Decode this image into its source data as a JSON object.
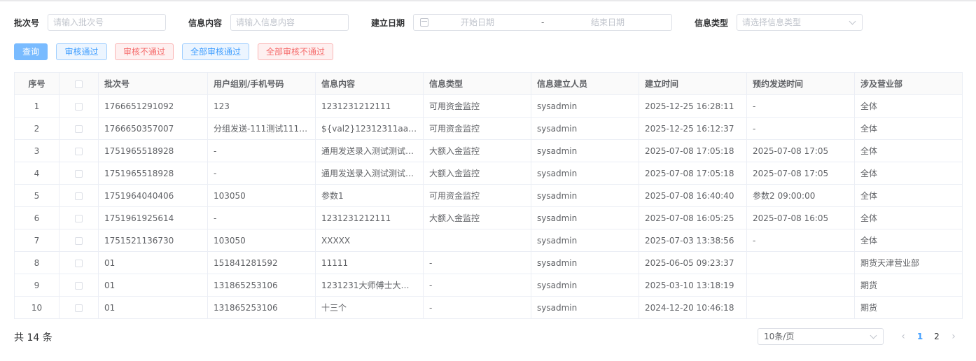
{
  "filters": {
    "batch_label": "批次号",
    "batch_placeholder": "请输入批次号",
    "content_label": "信息内容",
    "content_placeholder": "请输入信息内容",
    "date_label": "建立日期",
    "date_start_placeholder": "开始日期",
    "date_separator": "-",
    "date_end_placeholder": "结束日期",
    "type_label": "信息类型",
    "type_placeholder": "请选择信息类型"
  },
  "buttons": {
    "query": "查询",
    "approve": "审核通过",
    "reject": "审核不通过",
    "approve_all": "全部审核通过",
    "reject_all": "全部审核不通过"
  },
  "table": {
    "headers": [
      "序号",
      "",
      "批次号",
      "用户组别/手机号码",
      "信息内容",
      "信息类型",
      "信息建立人员",
      "建立时间",
      "预约发送时间",
      "涉及营业部"
    ],
    "rows": [
      {
        "no": "1",
        "batch": "1766651291092",
        "target": "123",
        "content": "1231231212111",
        "type": "可用资金监控",
        "creator": "sysadmin",
        "created": "2025-12-25 16:28:11",
        "scheduled": "-",
        "dept": "全体"
      },
      {
        "no": "2",
        "batch": "1766650357007",
        "target": "分组发送-111测试111…",
        "content": "${val2}12312311aaaau…",
        "type": "可用资金监控",
        "creator": "sysadmin",
        "created": "2025-12-25 16:12:37",
        "scheduled": "-",
        "dept": "全体"
      },
      {
        "no": "3",
        "batch": "1751965518928",
        "target": "-",
        "content": "通用发送录入测试测试…",
        "type": "大额入金监控",
        "creator": "sysadmin",
        "created": "2025-07-08 17:05:18",
        "scheduled": "2025-07-08 17:05",
        "dept": "全体"
      },
      {
        "no": "4",
        "batch": "1751965518928",
        "target": "-",
        "content": "通用发送录入测试测试…",
        "type": "大额入金监控",
        "creator": "sysadmin",
        "created": "2025-07-08 17:05:18",
        "scheduled": "2025-07-08 17:05",
        "dept": "全体"
      },
      {
        "no": "5",
        "batch": "1751964040406",
        "target": "103050",
        "content": "参数1",
        "type": "可用资金监控",
        "creator": "sysadmin",
        "created": "2025-07-08 16:40:40",
        "scheduled": "参数2 09:00:00",
        "dept": "全体"
      },
      {
        "no": "6",
        "batch": "1751961925614",
        "target": "-",
        "content": "1231231212111",
        "type": "大额入金监控",
        "creator": "sysadmin",
        "created": "2025-07-08 16:05:25",
        "scheduled": "2025-07-08 16:05",
        "dept": "全体"
      },
      {
        "no": "7",
        "batch": "1751521136730",
        "target": "103050",
        "content": "XXXXX",
        "type": "",
        "creator": "sysadmin",
        "created": "2025-07-03 13:38:56",
        "scheduled": "-",
        "dept": "全体"
      },
      {
        "no": "8",
        "batch": "01",
        "target": "151841281592",
        "content": "11111",
        "type": "-",
        "creator": "sysadmin",
        "created": "2025-06-05 09:23:37",
        "scheduled": "",
        "dept": "期货天津营业部"
      },
      {
        "no": "9",
        "batch": "01",
        "target": "131865253106",
        "content": "1231231大师傅士大夫…",
        "type": "-",
        "creator": "sysadmin",
        "created": "2025-03-10 13:18:19",
        "scheduled": "",
        "dept": "期货"
      },
      {
        "no": "10",
        "batch": "01",
        "target": "131865253106",
        "content": "十三个",
        "type": "-",
        "creator": "sysadmin",
        "created": "2024-12-20 10:46:18",
        "scheduled": "",
        "dept": "期货"
      }
    ]
  },
  "footer": {
    "total_text": "共 14 条",
    "page_size": "10条/页",
    "prev_icon": "chevron-left",
    "next_icon": "chevron-right",
    "pages": [
      "1",
      "2"
    ],
    "current_page": "1"
  },
  "colors": {
    "primary": "#409eff",
    "danger": "#f56c6c"
  }
}
